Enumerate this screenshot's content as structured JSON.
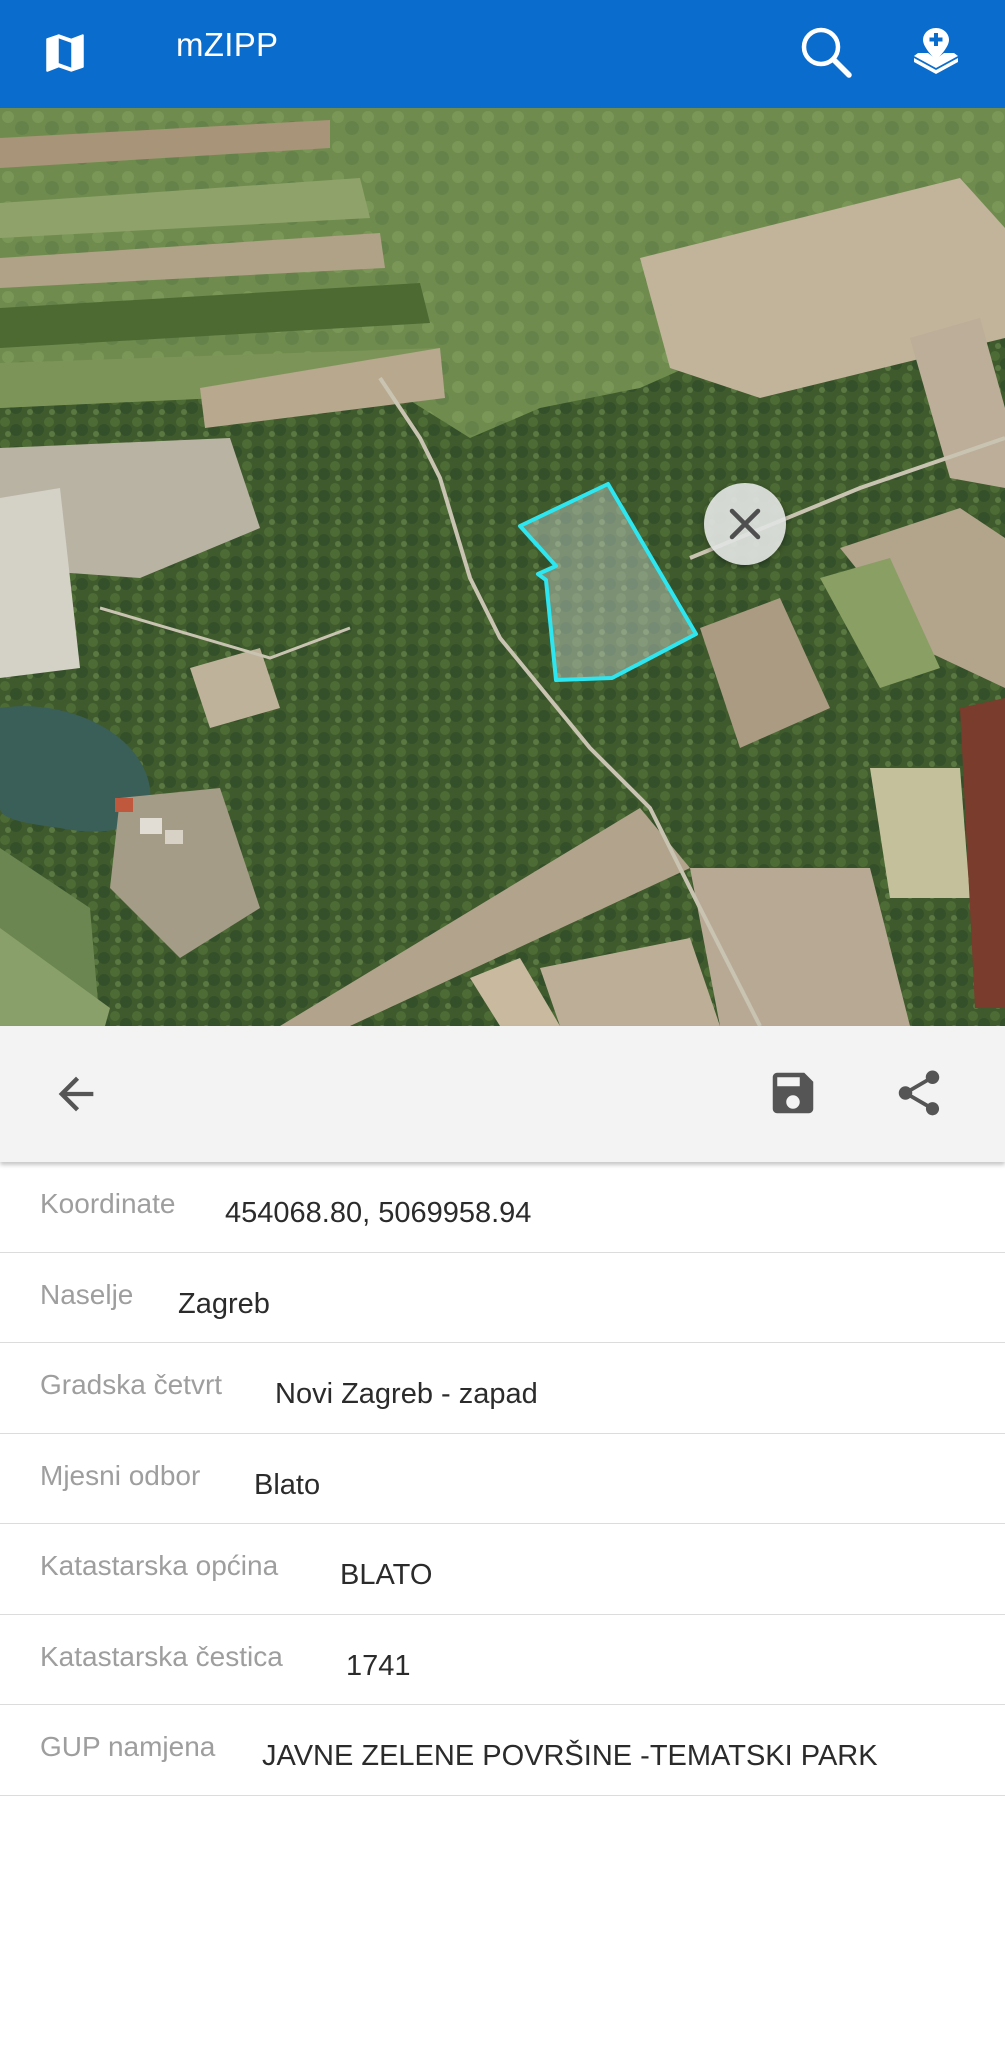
{
  "appbar": {
    "title": "mZIPP",
    "color": "#0a6ccc",
    "icons": [
      "map-icon",
      "search-icon",
      "layers-download-icon"
    ]
  },
  "map": {
    "parcel_outline_color": "#2ee6f0",
    "close_icon": "close-icon"
  },
  "toolbar": {
    "icons": [
      "back-arrow-icon",
      "save-icon",
      "share-icon"
    ]
  },
  "info": {
    "rows": [
      {
        "label": "Koordinate",
        "value": "454068.80, 5069958.94"
      },
      {
        "label": "Naselje",
        "value": "Zagreb"
      },
      {
        "label": "Gradska četvrt",
        "value": "Novi Zagreb - zapad"
      },
      {
        "label": "Mjesni odbor",
        "value": "Blato"
      },
      {
        "label": "Katastarska općina",
        "value": "BLATO"
      },
      {
        "label": "Katastarska čestica",
        "value": "1741"
      },
      {
        "label": "GUP namjena",
        "value": "JAVNE ZELENE POVRŠINE -TEMATSKI PARK"
      }
    ]
  }
}
